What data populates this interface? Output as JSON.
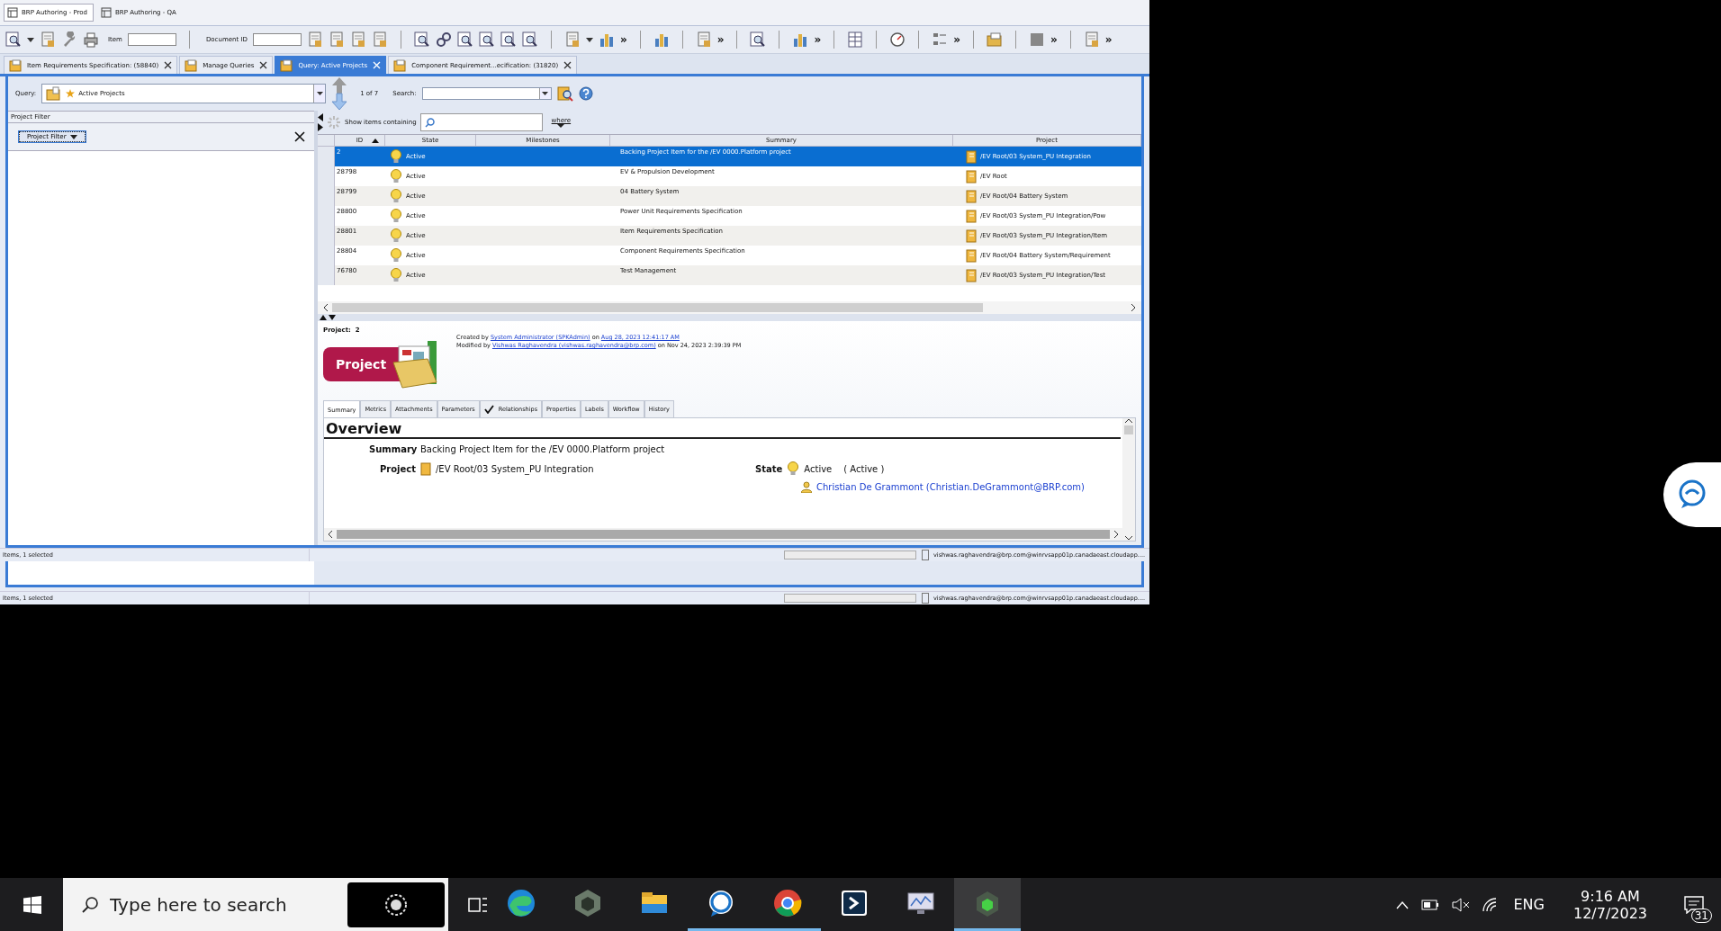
{
  "window_tabs": [
    {
      "label": "BRP Authoring - Prod",
      "selected": true
    },
    {
      "label": "BRP Authoring - QA",
      "selected": false
    }
  ],
  "toolbar": [
    {
      "kind": "tool"
    },
    {
      "kind": "caret"
    },
    {
      "kind": "tool"
    },
    {
      "kind": "tool"
    },
    {
      "kind": "tool"
    },
    {
      "kind": "label",
      "text": "Item"
    },
    {
      "kind": "field"
    },
    {
      "kind": "sep"
    },
    {
      "kind": "label",
      "text": "Document ID"
    },
    {
      "kind": "field"
    },
    {
      "kind": "tool"
    },
    {
      "kind": "tool"
    },
    {
      "kind": "tool"
    },
    {
      "kind": "tool"
    },
    {
      "kind": "sep"
    },
    {
      "kind": "tool"
    },
    {
      "kind": "tool"
    },
    {
      "kind": "tool"
    },
    {
      "kind": "tool"
    },
    {
      "kind": "tool"
    },
    {
      "kind": "tool"
    },
    {
      "kind": "sep"
    },
    {
      "kind": "tool"
    },
    {
      "kind": "caret"
    },
    {
      "kind": "tool"
    },
    {
      "kind": "more",
      "text": "»"
    },
    {
      "kind": "sep"
    },
    {
      "kind": "tool"
    },
    {
      "kind": "sep"
    },
    {
      "kind": "tool"
    },
    {
      "kind": "more",
      "text": "»"
    },
    {
      "kind": "sep"
    },
    {
      "kind": "tool"
    },
    {
      "kind": "sep"
    },
    {
      "kind": "tool"
    },
    {
      "kind": "more",
      "text": "»"
    },
    {
      "kind": "sep"
    },
    {
      "kind": "tool"
    },
    {
      "kind": "sep"
    },
    {
      "kind": "tool"
    },
    {
      "kind": "sep"
    },
    {
      "kind": "tool"
    },
    {
      "kind": "more",
      "text": "»"
    },
    {
      "kind": "sep"
    },
    {
      "kind": "tool"
    },
    {
      "kind": "sep"
    },
    {
      "kind": "tool"
    },
    {
      "kind": "more",
      "text": "»"
    },
    {
      "kind": "sep"
    },
    {
      "kind": "tool"
    },
    {
      "kind": "more",
      "text": "»"
    }
  ],
  "doc_tabs": [
    {
      "label": "Item Requirements Specification:  (58840)",
      "selected": false
    },
    {
      "label": "Manage Queries",
      "selected": false
    },
    {
      "label": "Query: Active Projects",
      "selected": true
    },
    {
      "label": "Component Requirement...ecification:  (31820)",
      "selected": false
    }
  ],
  "query": {
    "label": "Query:",
    "value": "Active Projects",
    "position": "1 of 7",
    "search_label": "Search:"
  },
  "project_filter": {
    "header": "Project Filter",
    "button": "Project Filter"
  },
  "items_filter": {
    "label": "Show items containing",
    "where": "where"
  },
  "table": {
    "columns": [
      "ID",
      "State",
      "Milestones",
      "Summary",
      "Project"
    ],
    "rows": [
      {
        "id": "2",
        "state": "Active",
        "milestones": "",
        "summary": "Backing Project Item for the /EV 0000.Platform project",
        "project": "/EV Root/03 System_PU Integration",
        "selected": true
      },
      {
        "id": "28798",
        "state": "Active",
        "summary": "EV & Propulsion Development",
        "project": "/EV Root",
        "selected": false
      },
      {
        "id": "28799",
        "state": "Active",
        "summary": "04 Battery System",
        "project": "/EV Root/04 Battery System",
        "selected": false
      },
      {
        "id": "28800",
        "state": "Active",
        "summary": "Power Unit Requirements Specification",
        "project": "/EV Root/03 System_PU Integration/Pow",
        "selected": false
      },
      {
        "id": "28801",
        "state": "Active",
        "summary": "Item Requirements Specification",
        "project": "/EV Root/03 System_PU Integration/Item",
        "selected": false
      },
      {
        "id": "28804",
        "state": "Active",
        "summary": "Component Requirements Specification",
        "project": "/EV Root/04 Battery System/Requirement",
        "selected": false
      },
      {
        "id": "76780",
        "state": "Active",
        "summary": "Test Management",
        "project": "/EV Root/03 System_PU Integration/Test",
        "selected": false
      }
    ]
  },
  "detail": {
    "heading": "Project:",
    "number": "2",
    "badge": "Project",
    "created": {
      "prefix": "Created by",
      "user": "System Administrator (SPKAdmin)",
      "on": "on",
      "date": "Aug 28, 2023 12:41:17 AM",
      "date_link": true
    },
    "modified": {
      "prefix": "Modified by",
      "user": "Vishwas Raghavendra (vishwas.raghavendra@brp.com)",
      "on": "on",
      "date": "Nov 24, 2023 2:39:39 PM",
      "date_link": false
    },
    "tabs": [
      {
        "label": "Summary",
        "selected": true,
        "checked": false
      },
      {
        "label": "Metrics",
        "selected": false,
        "checked": false
      },
      {
        "label": "Attachments",
        "selected": false,
        "checked": false
      },
      {
        "label": "Parameters",
        "selected": false,
        "checked": false
      },
      {
        "label": "Relationships",
        "selected": false,
        "checked": true
      },
      {
        "label": "Properties",
        "selected": false,
        "checked": false
      },
      {
        "label": "Labels",
        "selected": false,
        "checked": false
      },
      {
        "label": "Workflow",
        "selected": false,
        "checked": false
      },
      {
        "label": "History",
        "selected": false,
        "checked": false
      }
    ],
    "overview": {
      "title": "Overview",
      "summary_label": "Summary",
      "summary": "Backing Project Item for the /EV 0000.Platform project",
      "project_label": "Project",
      "project": "/EV Root/03 System_PU Integration",
      "state_label": "State",
      "state": "Active",
      "state_paren": "( Active )",
      "person": "Christian De Grammont (Christian.DeGrammont@BRP.com)"
    }
  },
  "status_bars": [
    {
      "left": "Items, 1 selected",
      "right": "vishwas.raghavendra@brp.com@winrvsapp01p.canadaeast.cloudapp...."
    },
    {
      "left": "Items, 1 selected",
      "right": "vishwas.raghavendra@brp.com@winrvsapp01p.canadaeast.cloudapp...."
    }
  ],
  "taskbar": {
    "search_placeholder": "Type here to search",
    "apps": [
      {
        "running": false,
        "selected": false
      },
      {
        "running": false,
        "selected": false
      },
      {
        "running": false,
        "selected": false
      },
      {
        "running": true,
        "selected": false
      },
      {
        "running": true,
        "selected": false
      },
      {
        "running": false,
        "selected": false
      },
      {
        "running": false,
        "selected": false
      },
      {
        "running": true,
        "selected": true
      }
    ],
    "language": "ENG",
    "time": "9:16 AM",
    "date": "12/7/2023",
    "notifications": "31"
  }
}
